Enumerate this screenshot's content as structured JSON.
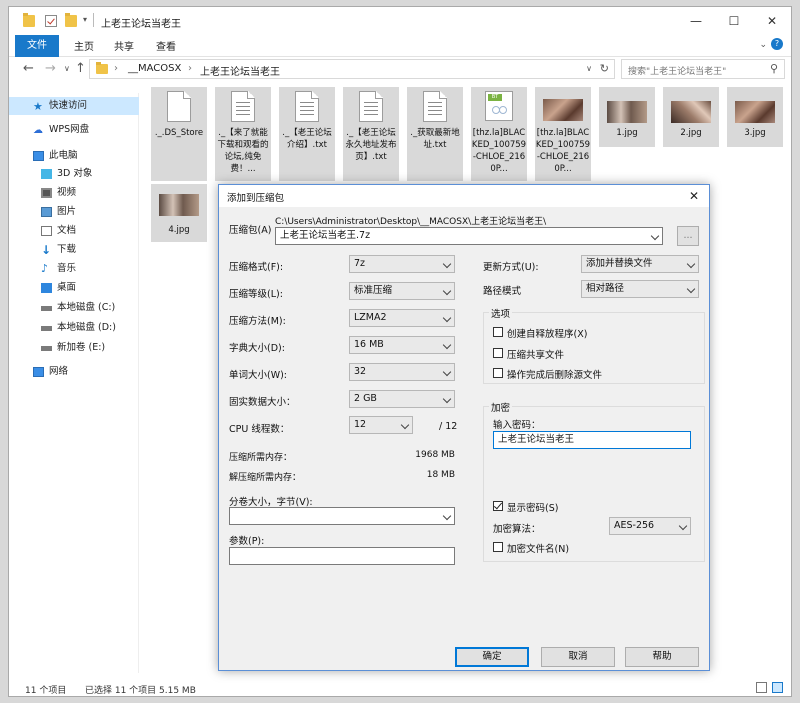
{
  "window": {
    "title": "上老王论坛当老王"
  },
  "ribbon": {
    "tabs": [
      "文件",
      "主页",
      "共享",
      "查看"
    ]
  },
  "address": {
    "path_sep": "›",
    "path": [
      "__MACOSX",
      "上老王论坛当老王"
    ],
    "search_placeholder": "搜索\"上老王论坛当老王\""
  },
  "sidebar": {
    "items": [
      {
        "label": "快速访问",
        "icon": "star-icon"
      },
      {
        "label": "WPS网盘",
        "icon": "cloud-icon"
      },
      {
        "label": "此电脑",
        "icon": "computer-icon"
      },
      {
        "label": "3D 对象",
        "icon": "cube-icon"
      },
      {
        "label": "视频",
        "icon": "video-icon"
      },
      {
        "label": "图片",
        "icon": "picture-icon"
      },
      {
        "label": "文档",
        "icon": "document-icon"
      },
      {
        "label": "下载",
        "icon": "download-icon"
      },
      {
        "label": "音乐",
        "icon": "music-icon"
      },
      {
        "label": "桌面",
        "icon": "desktop-icon"
      },
      {
        "label": "本地磁盘 (C:)",
        "icon": "drive-icon"
      },
      {
        "label": "本地磁盘 (D:)",
        "icon": "drive-icon"
      },
      {
        "label": "新加卷 (E:)",
        "icon": "drive-icon"
      },
      {
        "label": "网络",
        "icon": "network-icon"
      }
    ]
  },
  "files": [
    {
      "label": "._.DS_Store",
      "type": "blank"
    },
    {
      "label": "._【来了就能下载和观看的论坛,纯免费！...",
      "type": "text"
    },
    {
      "label": "._【老王论坛介绍】.txt",
      "type": "text"
    },
    {
      "label": "._【老王论坛永久地址发布页】.txt",
      "type": "text"
    },
    {
      "label": "._获取最新地址.txt",
      "type": "text"
    },
    {
      "label": "[thz.la]BLACKED_100759-CHLOE_2160P...",
      "type": "torrent"
    },
    {
      "label": "[thz.la]BLACKED_100759-CHLOE_2160P...",
      "type": "image"
    },
    {
      "label": "1.jpg",
      "type": "image"
    },
    {
      "label": "2.jpg",
      "type": "image"
    },
    {
      "label": "3.jpg",
      "type": "image"
    },
    {
      "label": "4.jpg",
      "type": "image"
    }
  ],
  "status": {
    "count": "11 个项目",
    "selected": "已选择 11 个项目  5.15 MB"
  },
  "dialog": {
    "title": "添加到压缩包",
    "archive_label": "压缩包(A)",
    "archive_dir": "C:\\Users\\Administrator\\Desktop\\__MACOSX\\上老王论坛当老王\\",
    "archive_name": "上老王论坛当老王.7z",
    "browse_label": "...",
    "format_label": "压缩格式(F):",
    "format_value": "7z",
    "level_label": "压缩等级(L):",
    "level_value": "标准压缩",
    "method_label": "压缩方法(M):",
    "method_value": "LZMA2",
    "dict_label": "字典大小(D):",
    "dict_value": "16 MB",
    "word_label": "单词大小(W):",
    "word_value": "32",
    "solid_label": "固实数据大小：",
    "solid_value": "2 GB",
    "cpu_label": "CPU 线程数：",
    "cpu_value": "12",
    "cpu_total": "/ 12",
    "mem_comp_label": "压缩所需内存：",
    "mem_comp_value": "1968 MB",
    "mem_decomp_label": "解压缩所需内存：",
    "mem_decomp_value": "18 MB",
    "split_label": "分卷大小，字节(V):",
    "split_value": "",
    "params_label": "参数(P):",
    "params_value": "",
    "update_label": "更新方式(U):",
    "update_value": "添加并替换文件",
    "path_label": "路径模式",
    "path_value": "相对路径",
    "options_title": "选项",
    "opt_sfx": "创建自释放程序(X)",
    "opt_shared": "压缩共享文件",
    "opt_delete": "操作完成后删除源文件",
    "encrypt_title": "加密",
    "password_label": "输入密码：",
    "password_value": "上老王论坛当老王",
    "show_password": "显示密码(S)",
    "enc_method_label": "加密算法：",
    "enc_method_value": "AES-256",
    "enc_names": "加密文件名(N)",
    "ok": "确定",
    "cancel": "取消",
    "help": "帮助"
  }
}
